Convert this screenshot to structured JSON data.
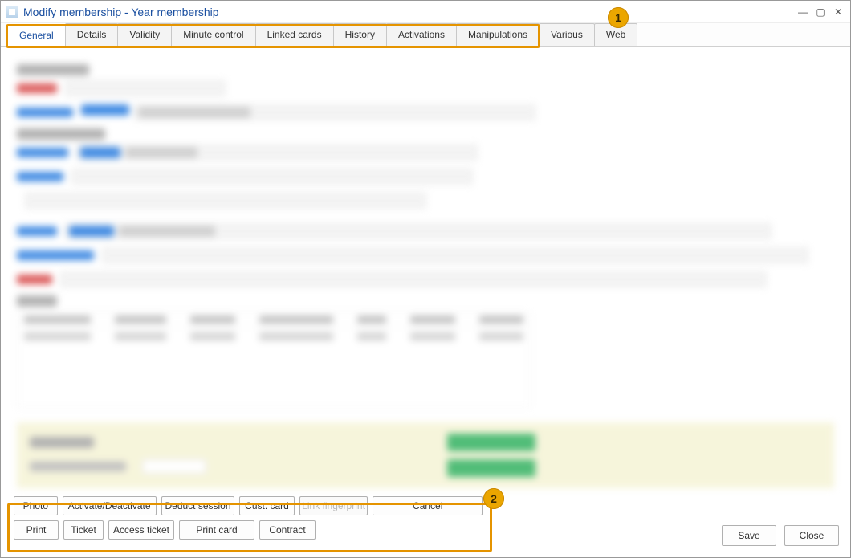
{
  "window": {
    "title": "Modify membership - Year membership"
  },
  "tabs": [
    {
      "label": "General",
      "active": true
    },
    {
      "label": "Details"
    },
    {
      "label": "Validity"
    },
    {
      "label": "Minute control"
    },
    {
      "label": "Linked cards"
    },
    {
      "label": "History"
    },
    {
      "label": "Activations"
    },
    {
      "label": "Manipulations"
    },
    {
      "label": "Various"
    },
    {
      "label": "Web"
    }
  ],
  "tray_row1": [
    {
      "label": "Photo",
      "w": 56
    },
    {
      "label": "Activate/Deactivate",
      "w": 120
    },
    {
      "label": "Deduct session",
      "w": 94
    },
    {
      "label": "Cust. card",
      "w": 70
    },
    {
      "label": "Link fingerprint",
      "w": 88,
      "disabled": true
    },
    {
      "label": "Cancel",
      "w": 140
    }
  ],
  "tray_row2": [
    {
      "label": "Print",
      "w": 56
    },
    {
      "label": "Ticket",
      "w": 50
    },
    {
      "label": "Access ticket",
      "w": 82
    },
    {
      "label": "Print card",
      "w": 94
    },
    {
      "label": "Contract",
      "w": 70
    }
  ],
  "footer": {
    "save": "Save",
    "close": "Close"
  },
  "annotations": {
    "a1": "1",
    "a2": "2"
  }
}
